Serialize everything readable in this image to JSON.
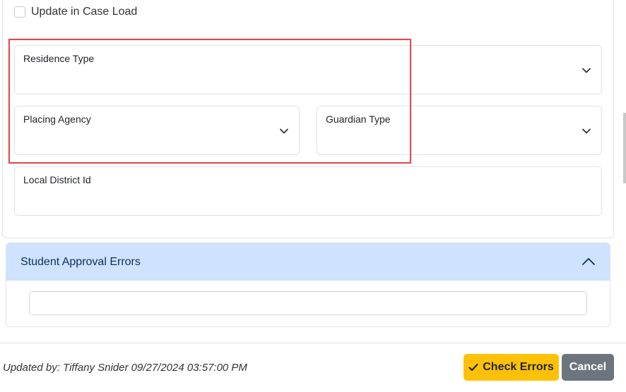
{
  "form": {
    "update_checkbox_label": "Update in Case Load",
    "residence_type_label": "Residence Type",
    "placing_agency_label": "Placing Agency",
    "guardian_type_label": "Guardian Type",
    "local_district_id_label": "Local District Id"
  },
  "accordion": {
    "title": "Student Approval Errors",
    "errors_value": ""
  },
  "footer": {
    "updated_by": "Updated by: Tiffany Snider 09/27/2024 03:57:00 PM",
    "check_errors_label": "Check Errors",
    "cancel_label": "Cancel"
  },
  "colors": {
    "accordion_header": "#cfe2ff",
    "check_button": "#ffc107",
    "cancel_button": "#6c757d",
    "highlight": "#e5484d"
  }
}
